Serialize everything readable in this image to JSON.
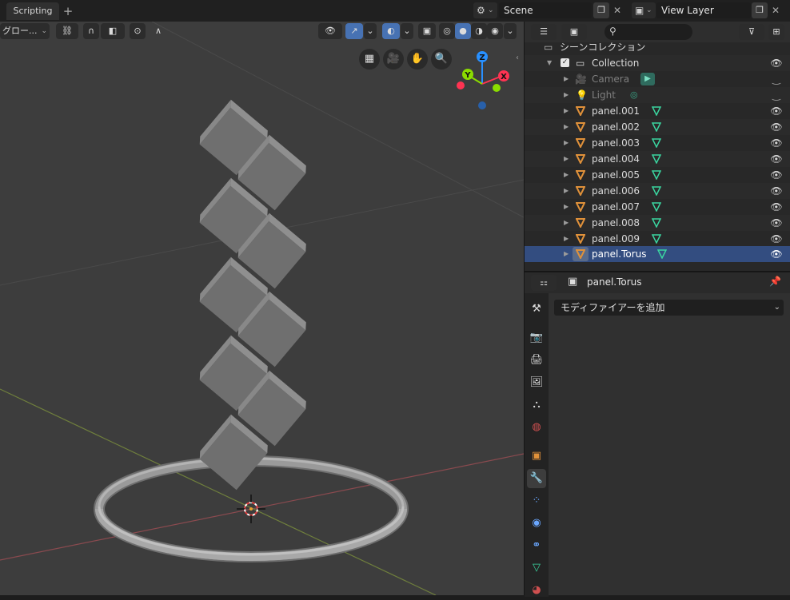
{
  "topbar": {
    "workspace_tab": "Scripting",
    "add_tab": "+",
    "scene_name": "Scene",
    "view_layer": "View Layer"
  },
  "viewport": {
    "transform_orientation": "グロー...",
    "gizmo": {
      "x_label": "X",
      "y_label": "Y",
      "z_label": "Z"
    }
  },
  "outliner": {
    "search_placeholder": "",
    "scene_collection": "シーンコレクション",
    "collection": "Collection",
    "items": [
      {
        "label": "Camera",
        "kind": "camera",
        "dimmed": true
      },
      {
        "label": "Light",
        "kind": "light",
        "dimmed": true
      },
      {
        "label": "panel.001",
        "kind": "mesh"
      },
      {
        "label": "panel.002",
        "kind": "mesh"
      },
      {
        "label": "panel.003",
        "kind": "mesh"
      },
      {
        "label": "panel.004",
        "kind": "mesh"
      },
      {
        "label": "panel.005",
        "kind": "mesh"
      },
      {
        "label": "panel.006",
        "kind": "mesh"
      },
      {
        "label": "panel.007",
        "kind": "mesh"
      },
      {
        "label": "panel.008",
        "kind": "mesh"
      },
      {
        "label": "panel.009",
        "kind": "mesh"
      },
      {
        "label": "panel.Torus",
        "kind": "mesh",
        "selected": true
      }
    ]
  },
  "properties": {
    "object_name": "panel.Torus",
    "add_modifier": "モディファイアーを追加"
  },
  "colors": {
    "accent_blue": "#4772b3",
    "mesh_orange": "#e0913a",
    "mesh_data_green": "#3bd6a0",
    "axis_x": "#ff3352",
    "axis_y": "#8bdc00",
    "axis_z": "#2890ff"
  }
}
